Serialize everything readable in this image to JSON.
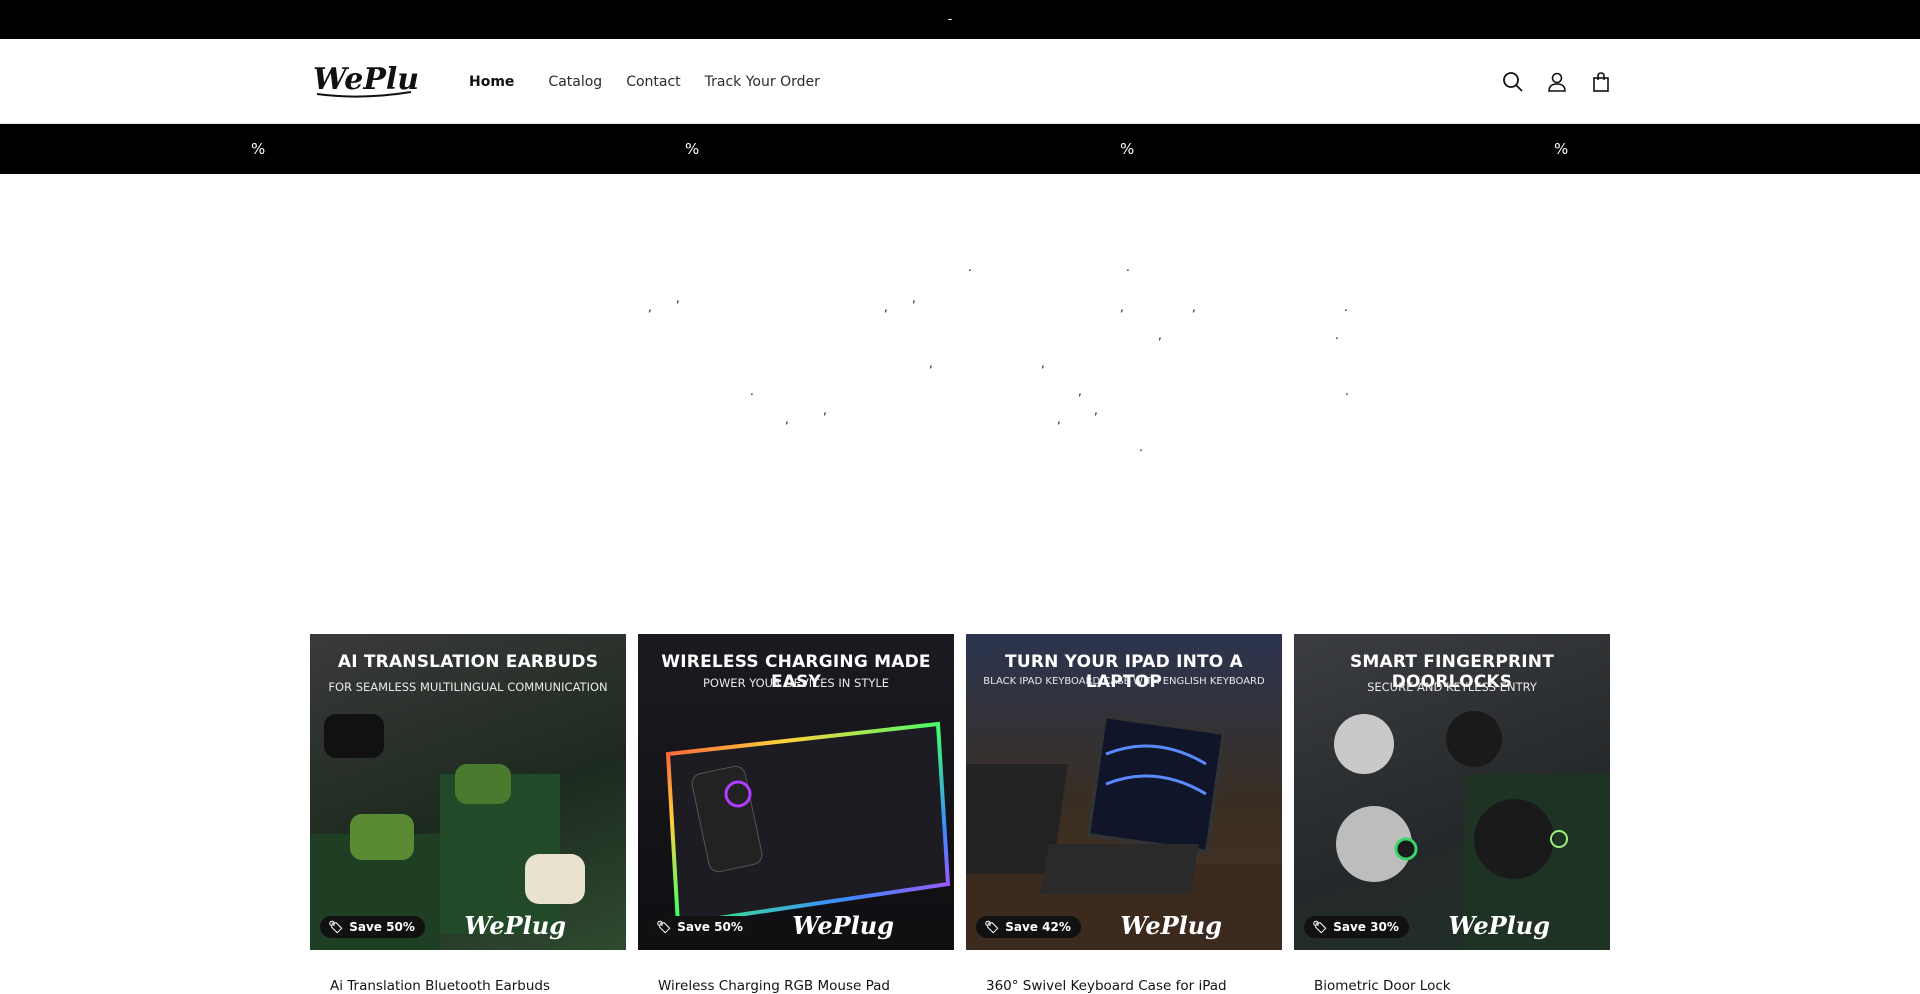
{
  "announcement": {
    "text": "-"
  },
  "header": {
    "logo_text": "WePlug",
    "nav": [
      {
        "label": "Home",
        "active": true
      },
      {
        "label": "Catalog",
        "active": false
      },
      {
        "label": "Contact",
        "active": false
      },
      {
        "label": "Track Your Order",
        "active": false
      }
    ],
    "icons": [
      "search-icon",
      "account-icon",
      "cart-icon"
    ]
  },
  "marquee": {
    "items": [
      "%",
      "%",
      "%",
      "%"
    ]
  },
  "hero": {
    "punctuation": [
      ".",
      ".",
      ",",
      ",",
      ",",
      ",",
      ",",
      ",",
      ".",
      ",",
      ".",
      ",",
      ",",
      ".",
      ",",
      ".",
      ",",
      ",",
      ",",
      ",",
      "."
    ]
  },
  "products": [
    {
      "title": "Ai Translation Bluetooth Earbuds",
      "headline": "AI TRANSLATION EARBUDS",
      "subline": "FOR SEAMLESS MULTILINGUAL COMMUNICATION",
      "badge": "Save 50%",
      "brand": "WePlug",
      "bg": "#1f2a22"
    },
    {
      "title": "Wireless Charging RGB Mouse Pad",
      "headline": "WIRELESS CHARGING MADE EASY",
      "subline": "POWER YOUR DEVICES IN STYLE",
      "badge": "Save 50%",
      "brand": "WePlug",
      "bg": "#141419"
    },
    {
      "title": "360° Swivel Keyboard Case for iPad",
      "headline": "TURN YOUR IPAD INTO A LAPTOP",
      "subline": "BLACK IPAD KEYBOARD CASE WITH ENGLISH KEYBOARD",
      "badge": "Save 42%",
      "brand": "WePlug",
      "bg": "#2a2621"
    },
    {
      "title": "Biometric Door Lock",
      "headline": "SMART FINGERPRINT DOORLOCKS",
      "subline": "SECURE AND KEYLESS ENTRY",
      "badge": "Save 30%",
      "brand": "WePlug",
      "bg": "#26292a"
    }
  ]
}
